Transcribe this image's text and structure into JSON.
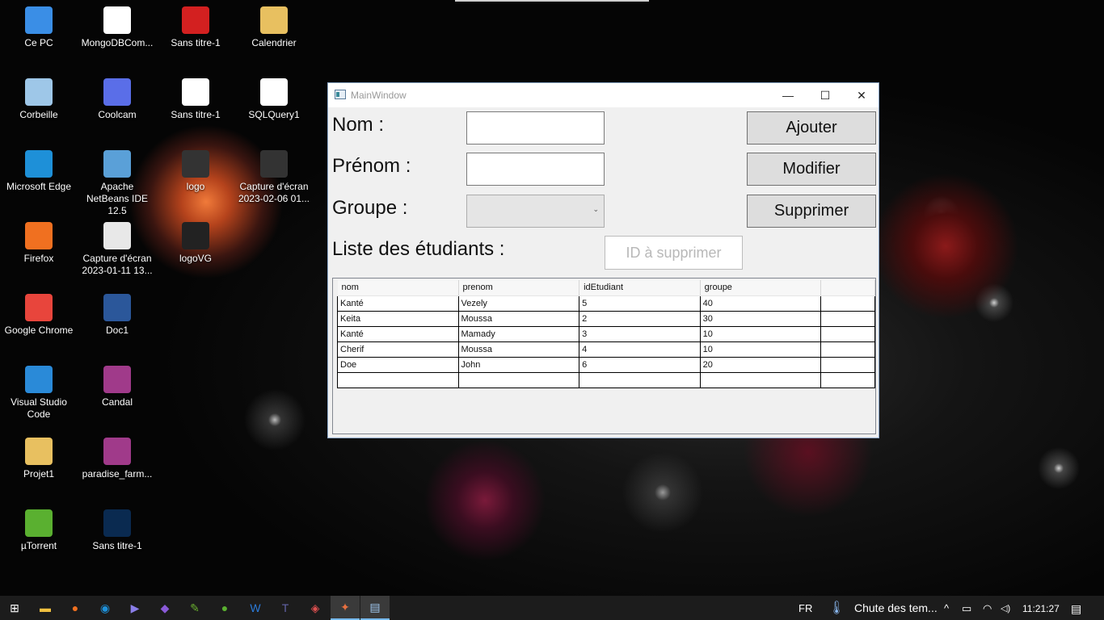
{
  "desktop": {
    "icons": [
      {
        "label": "Ce PC",
        "icon": "computer-icon",
        "color": "#3a8ee6"
      },
      {
        "label": "MongoDBCom...",
        "icon": "mongodb-icon",
        "color": "#ffffff"
      },
      {
        "label": "Sans titre-1",
        "icon": "pdf-icon",
        "color": "#d32020"
      },
      {
        "label": "Calendrier",
        "icon": "archive-icon",
        "color": "#e8c060"
      },
      {
        "label": "Corbeille",
        "icon": "recycle-bin-icon",
        "color": "#9ec7e8"
      },
      {
        "label": "Coolcam",
        "icon": "coolcam-icon",
        "color": "#5a6ee8"
      },
      {
        "label": "Sans titre-1",
        "icon": "image-file-icon",
        "color": "#ffffff"
      },
      {
        "label": "SQLQuery1",
        "icon": "sql-file-icon",
        "color": "#ffffff"
      },
      {
        "label": "Microsoft Edge",
        "icon": "edge-icon",
        "color": "#1e90d8"
      },
      {
        "label": "Apache NetBeans IDE 12.5",
        "icon": "netbeans-icon",
        "color": "#5aa0d8"
      },
      {
        "label": "logo",
        "icon": "logo-image-icon",
        "color": "#333333"
      },
      {
        "label": "Capture d'écran 2023-02-06 01...",
        "icon": "screenshot-icon",
        "color": "#333333"
      },
      {
        "label": "Firefox",
        "icon": "firefox-icon",
        "color": "#f07020"
      },
      {
        "label": "Capture d'écran 2023-01-11 13...",
        "icon": "screenshot-icon",
        "color": "#e8e8e8"
      },
      {
        "label": "logoVG",
        "icon": "logo-image-icon",
        "color": "#222222"
      },
      {
        "label": "Google Chrome",
        "icon": "chrome-icon",
        "color": "#e8453c"
      },
      {
        "label": "Doc1",
        "icon": "word-doc-icon",
        "color": "#2b579a"
      },
      {
        "label": "Visual Studio Code",
        "icon": "vscode-icon",
        "color": "#2a8ad8"
      },
      {
        "label": "Candal",
        "icon": "winrar-icon",
        "color": "#a03a8a"
      },
      {
        "label": "Projet1",
        "icon": "archive-icon",
        "color": "#e8c060"
      },
      {
        "label": "paradise_farm...",
        "icon": "winrar-icon",
        "color": "#a03a8a"
      },
      {
        "label": "µTorrent",
        "icon": "utorrent-icon",
        "color": "#5ab030"
      },
      {
        "label": "Sans titre-1",
        "icon": "photoshop-icon",
        "color": "#0a2a50"
      }
    ]
  },
  "window": {
    "title": "MainWindow",
    "minimize_glyph": "—",
    "maximize_glyph": "☐",
    "close_glyph": "✕",
    "nom_label": "Nom :",
    "prenom_label": "Prénom :",
    "groupe_label": "Groupe :",
    "liste_label": "Liste des étudiants :",
    "nom_value": "",
    "prenom_value": "",
    "groupe_selected": "",
    "combo_arrow": "⌄",
    "ajouter_label": "Ajouter",
    "modifier_label": "Modifier",
    "supprimer_label": "Supprimer",
    "id_placeholder": "ID à supprimer",
    "grid": {
      "columns": [
        "nom",
        "prenom",
        "idEtudiant",
        "groupe"
      ],
      "rows": [
        [
          "Kanté",
          "Vezely",
          "5",
          "40"
        ],
        [
          "Keita",
          "Moussa",
          "2",
          "30"
        ],
        [
          "Kanté",
          "Mamady",
          "3",
          "10"
        ],
        [
          "Cherif",
          "Moussa",
          "4",
          "10"
        ],
        [
          "Doe",
          "John",
          "6",
          "20"
        ],
        [
          "",
          "",
          "",
          ""
        ]
      ]
    }
  },
  "taskbar": {
    "items": [
      {
        "name": "start-icon",
        "glyph": "⊞",
        "color": "#ffffff"
      },
      {
        "name": "file-explorer-icon",
        "glyph": "▬",
        "color": "#f0c040"
      },
      {
        "name": "firefox-icon",
        "glyph": "●",
        "color": "#f07020"
      },
      {
        "name": "edge-icon",
        "glyph": "◉",
        "color": "#1e90d8"
      },
      {
        "name": "coolcam-icon",
        "glyph": "▶",
        "color": "#8a7ee8"
      },
      {
        "name": "visual-studio-icon",
        "glyph": "◆",
        "color": "#8a5ad8"
      },
      {
        "name": "greenshot-icon",
        "glyph": "✎",
        "color": "#6ab030"
      },
      {
        "name": "utorrent-icon",
        "glyph": "●",
        "color": "#5ab030"
      },
      {
        "name": "word-icon",
        "glyph": "W",
        "color": "#2b7ad8"
      },
      {
        "name": "teams-icon",
        "glyph": "T",
        "color": "#6264a7"
      },
      {
        "name": "app-icon",
        "glyph": "◈",
        "color": "#e05050"
      },
      {
        "name": "netbeans-icon",
        "glyph": "✦",
        "color": "#e87040"
      },
      {
        "name": "wpf-app-icon",
        "glyph": "▤",
        "color": "#a0c8f0"
      }
    ],
    "language": "FR",
    "weather": "Chute des tem...",
    "time": "11:21:27",
    "tray_chevron": "^",
    "battery_glyph": "▭",
    "wifi_glyph": "◠",
    "volume_glyph": "◁)",
    "notification_glyph": "▤"
  }
}
